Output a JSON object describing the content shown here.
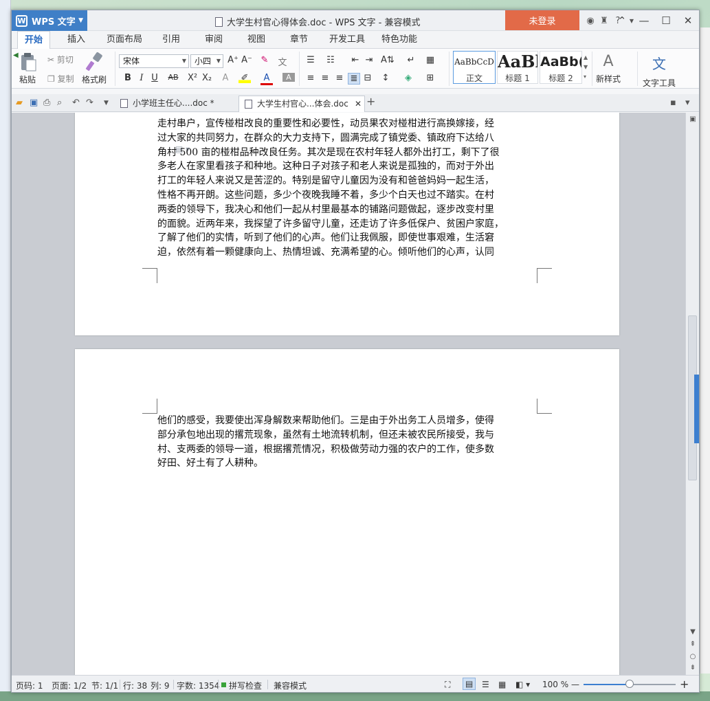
{
  "app": {
    "name": "WPS 文字",
    "window_title": "大学生村官心得体会.doc - WPS 文字 - 兼容模式",
    "login_label": "未登录"
  },
  "ribbon_tabs": [
    "开始",
    "插入",
    "页面布局",
    "引用",
    "审阅",
    "视图",
    "章节",
    "开发工具",
    "特色功能"
  ],
  "ribbon": {
    "paste": "粘贴",
    "cut": "剪切",
    "copy": "复制",
    "format_painter": "格式刷",
    "font_name": "宋体",
    "font_size": "小四",
    "styles": [
      {
        "sample": "AaBbCcD",
        "label": "正文"
      },
      {
        "sample": "AaBl",
        "label": "标题 1"
      },
      {
        "sample": "AaBb(",
        "label": "标题 2"
      }
    ],
    "new_style": "新样式",
    "text_tools": "文字工具"
  },
  "doc_tabs": [
    {
      "label": "小学班主任心....doc *",
      "active": false
    },
    {
      "label": "大学生村官心...体会.doc",
      "active": true
    }
  ],
  "page1_lines": [
    "走村串户，宣传椪柑改良的重要性和必要性，动员果农对椪柑进行高换嫁接，经",
    "过大家的共同努力，在群众的大力支持下，圆满完成了镇党委、镇政府下达给八",
    "角村 500 亩的椪柑品种改良任务。其次是现在农村年轻人都外出打工，剩下了很",
    "多老人在家里看孩子和种地。这种日子对孩子和老人来说是孤独的，而对于外出",
    "打工的年轻人来说又是苦涩的。特别是留守儿童因为没有和爸爸妈妈一起生活，",
    "性格不再开朗。这些问题，多少个夜晚我睡不着，多少个白天也过不踏实。在村",
    "两委的领导下，我决心和他们一起从村里最基本的铺路问题做起，逐步改变村里",
    "的面貌。近两年来，我探望了许多留守儿童，还走访了许多低保户、贫困户家庭，",
    "了解了他们的实情，听到了他们的心声。他们让我佩服，即使世事艰难，生活窘",
    "迫，依然有着一颗健康向上、热情坦诚、充满希望的心。倾听他们的心声，认同"
  ],
  "page2_lines": [
    "他们的感受，我要使出浑身解数来帮助他们。三是由于外出务工人员增多，使得",
    "部分承包地出现的撂荒现象，虽然有土地流转机制，但还未被农民所接受，我与",
    "村、支两委的领导一道，根据撂荒情况，积极做劳动力强的农户的工作，使多数",
    "好田、好土有了人耕种。"
  ],
  "status": {
    "page_code": "页码: 1",
    "page": "页面: 1/2",
    "section": "节: 1/1",
    "row": "行: 38",
    "col": "列: 9",
    "word_count": "字数: 1354",
    "spell_check": "拼写检查",
    "compat_mode": "兼容模式",
    "zoom": "100 %"
  },
  "colors": {
    "accent": "#3f7fc7",
    "login": "#e26a48"
  }
}
